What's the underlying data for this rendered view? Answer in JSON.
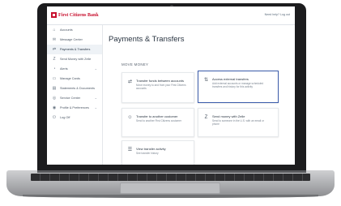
{
  "app": {
    "logo_text": "First Citizens Bank",
    "user_link": "Need help? Log out"
  },
  "sidebar": {
    "items": [
      {
        "label": "Accounts",
        "icon": "bank-icon"
      },
      {
        "label": "Message Center",
        "icon": "mail-icon"
      },
      {
        "label": "Payments & Transfers",
        "icon": "transfer-icon"
      },
      {
        "label": "Send Money with Zelle",
        "icon": "zelle-icon"
      },
      {
        "label": "Alerts",
        "icon": "alert-icon"
      },
      {
        "label": "Manage Cards",
        "icon": "card-icon"
      },
      {
        "label": "Statements & Documents",
        "icon": "document-icon"
      },
      {
        "label": "Service Center",
        "icon": "service-icon"
      },
      {
        "label": "Profile & Preferences",
        "icon": "person-icon"
      },
      {
        "label": "Log Off",
        "icon": "power-icon"
      }
    ]
  },
  "main": {
    "title": "Payments & Transfers",
    "section_label": "MOVE MONEY",
    "cards": [
      {
        "title": "Transfer funds between accounts",
        "desc": "Move money to and from your First Citizens accounts",
        "icon": "transfer-icon"
      },
      {
        "title": "Access external transfers",
        "desc": "Add external accounts or manage scheduled transfers and history for this activity",
        "icon": "external-transfer-icon"
      },
      {
        "title": "Transfer to another customer",
        "desc": "Send to another First Citizens customer",
        "icon": "customer-icon"
      },
      {
        "title": "Send money with Zelle",
        "desc": "Send to someone in the U.S. with an email or phone",
        "icon": "zelle-icon"
      },
      {
        "title": "View transfer activity",
        "desc": "See transfer history",
        "icon": "activity-icon"
      }
    ]
  },
  "colors": {
    "brand": "#c8102e",
    "selected_border": "#3b5cab"
  }
}
